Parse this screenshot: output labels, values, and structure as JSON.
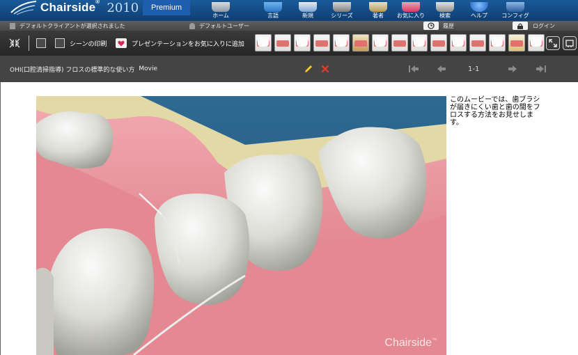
{
  "header": {
    "app_name": "Chairside",
    "trademark": "®",
    "year": "2010",
    "edition": "Premium",
    "nav": [
      {
        "label": "ホーム",
        "icon": "home-icon"
      },
      {
        "label": "言語",
        "icon": "globe-icon"
      },
      {
        "label": "新規",
        "icon": "new-icon"
      },
      {
        "label": "シリーズ",
        "icon": "series-icon"
      },
      {
        "label": "著者",
        "icon": "author-icon"
      },
      {
        "label": "お気に入り",
        "icon": "favorites-icon"
      },
      {
        "label": "検索",
        "icon": "search-icon"
      },
      {
        "label": "ヘルプ",
        "icon": "help-icon"
      },
      {
        "label": "コンフィグ",
        "icon": "config-icon"
      }
    ]
  },
  "status": {
    "client": "デフォルトクライアントが選択されました",
    "user": "デフォルトユーザー",
    "history": "履歴",
    "login": "ログイン"
  },
  "toolbar": {
    "print_scene": "シーンの印刷",
    "add_favorite": "プレゼンテーションをお気に入りに追加",
    "thumbnail_count": 17
  },
  "scene": {
    "title": "OHI(口腔清掃指導) フロスの標準的な使い方",
    "type": "Movie",
    "page": "1-1"
  },
  "movie": {
    "watermark": "Chairside",
    "watermark_tm": "™"
  },
  "description": "このムービーでは、歯ブラシが届きにくい歯と歯の間をフロスする方法をお見せします。",
  "colors": {
    "header_blue": "#1a5a99",
    "status_gray": "#555555",
    "toolbar_dark": "#2f2f2f",
    "titlebar_gray": "#444444",
    "gum_pink": "#e28a92",
    "edit_yellow": "#f0d23a",
    "delete_red": "#e03a2a"
  }
}
